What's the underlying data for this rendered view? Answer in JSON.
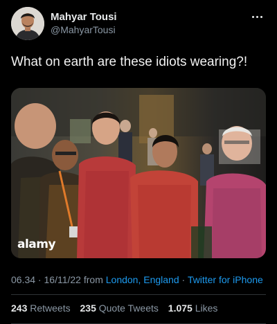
{
  "author": {
    "display_name": "Mahyar Tousi",
    "handle": "@MahyarTousi"
  },
  "tweet": {
    "text": "What on earth are these idiots wearing?!",
    "image_watermark": "alamy"
  },
  "meta": {
    "time": "06.34",
    "separator1": " · ",
    "date": "16/11/22",
    "from_label": " from ",
    "location": "London, England",
    "separator2": " · ",
    "client": "Twitter for iPhone"
  },
  "stats": {
    "retweets_count": "243",
    "retweets_label": "Retweets",
    "quotes_count": "235",
    "quotes_label": "Quote Tweets",
    "likes_count": "1.075",
    "likes_label": "Likes"
  },
  "colors": {
    "background": "#000000",
    "text": "#e7e9ea",
    "secondary": "#8b98a5",
    "link": "#1d9bf0",
    "divider": "#2f3336"
  }
}
